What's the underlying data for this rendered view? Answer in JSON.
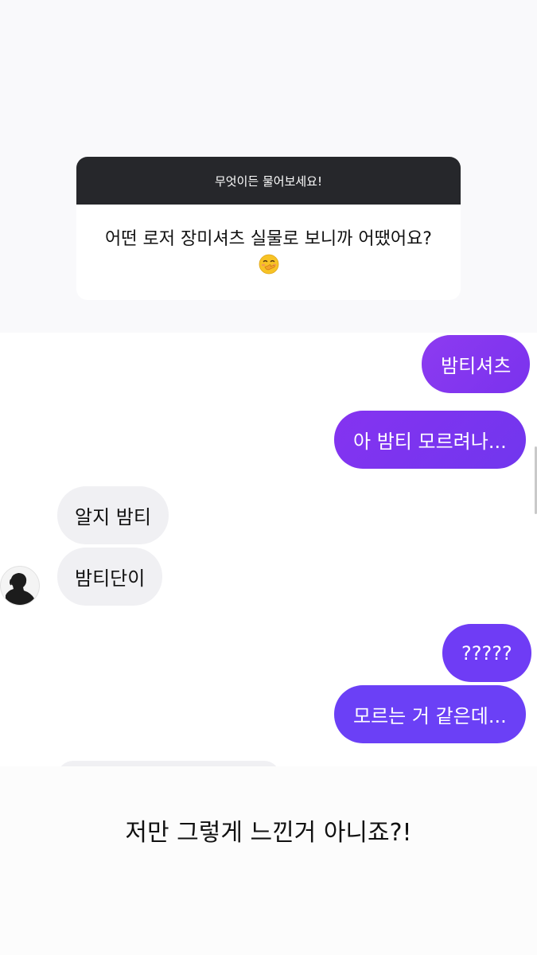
{
  "question_card": {
    "header": "무엇이든 물어보세요!",
    "question": "어떤 로저 장미셔츠 실물로 보니까 어땠어요?",
    "emoji": "face-with-hand-over-mouth-icon"
  },
  "chat": {
    "messages": [
      {
        "sender": "me",
        "text": "밤티셔츠"
      },
      {
        "sender": "me",
        "text": "아 밤티 모르려나..."
      },
      {
        "sender": "other",
        "text": "알지 밤티"
      },
      {
        "sender": "other",
        "text": "밤티단이"
      },
      {
        "sender": "me",
        "text": "?????"
      },
      {
        "sender": "me",
        "text": "모르는 거 같은데..."
      }
    ],
    "colors": {
      "outgoing_start": "#8d3bf0",
      "outgoing_end": "#6b40f6",
      "incoming": "#f0f0f3"
    }
  },
  "caption": "저만 그렇게 느낀거 아니죠?!"
}
